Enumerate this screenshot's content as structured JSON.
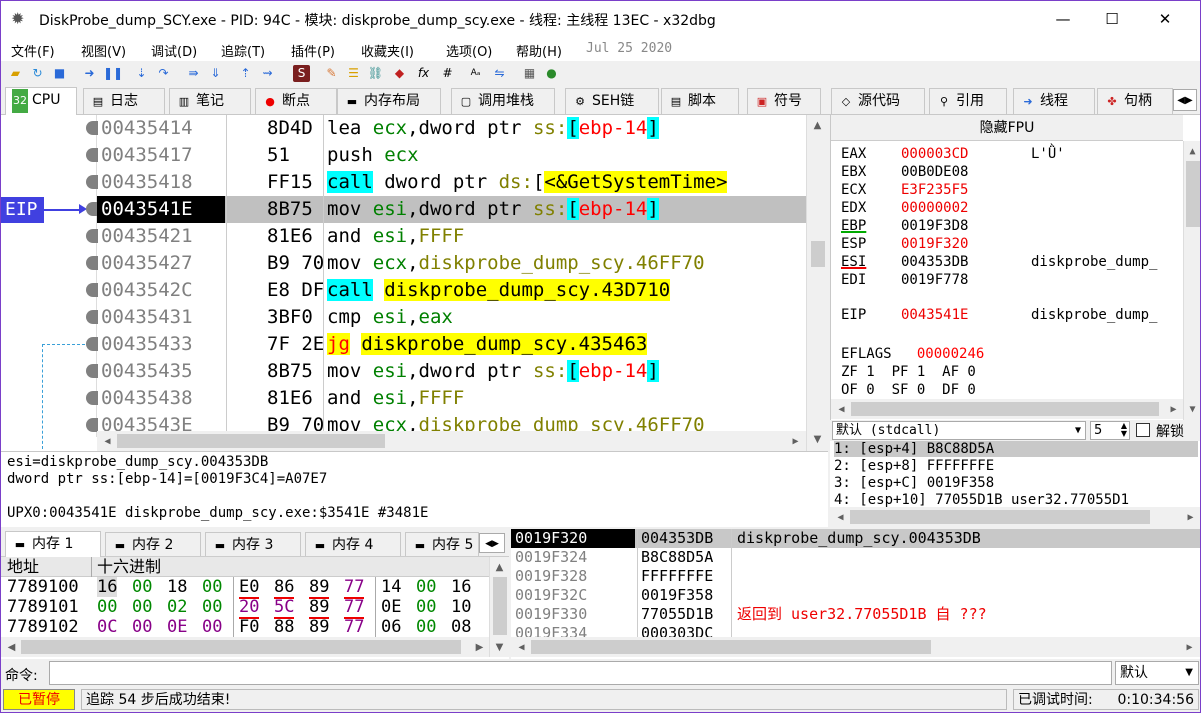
{
  "title": "DiskProbe_dump_SCY.exe - PID: 94C - 模块: diskprobe_dump_scy.exe - 线程: 主线程 13EC - x32dbg",
  "window_buttons": {
    "min": "—",
    "max": "☐",
    "close": "✕"
  },
  "menu": [
    "文件(F)",
    "视图(V)",
    "调试(D)",
    "追踪(T)",
    "插件(P)",
    "收藏夹(I)",
    "选项(O)",
    "帮助(H)",
    "Jul 25 2020"
  ],
  "tabs": [
    "CPU",
    "日志",
    "笔记",
    "断点",
    "内存布局",
    "调用堆栈",
    "SEH链",
    "脚本",
    "符号",
    "源代码",
    "引用",
    "线程",
    "句柄"
  ],
  "eip_label": "EIP",
  "disasm": [
    {
      "addr": "00435414",
      "bytes": "8D4D",
      "parts": [
        [
          "lea ",
          ""
        ],
        [
          "ecx",
          "reg"
        ],
        [
          ",",
          ""
        ],
        [
          "dword ptr ",
          "kw"
        ],
        [
          "ss:",
          "seg"
        ],
        [
          "[",
          "brk"
        ],
        [
          "ebp-14",
          "red"
        ],
        [
          "]",
          "brk"
        ]
      ]
    },
    {
      "addr": "00435417",
      "bytes": "51",
      "parts": [
        [
          "push ",
          ""
        ],
        [
          "ecx",
          "reg"
        ]
      ]
    },
    {
      "addr": "00435418",
      "bytes": "FF15",
      "parts": [
        [
          "call",
          "call"
        ],
        [
          " dword ptr ",
          ""
        ],
        [
          "ds:",
          "seg"
        ],
        [
          "[",
          ""
        ],
        [
          "<&GetSystemTime>",
          "yel"
        ]
      ]
    },
    {
      "addr": "0043541E",
      "bytes": "8B75",
      "parts": [
        [
          "mov ",
          ""
        ],
        [
          "esi",
          "reg"
        ],
        [
          ",",
          ""
        ],
        [
          "dword ptr ",
          ""
        ],
        [
          "ss:",
          "seg"
        ],
        [
          "[",
          "brk"
        ],
        [
          "ebp-14",
          "red"
        ],
        [
          "]",
          "brk"
        ]
      ],
      "eip": true
    },
    {
      "addr": "00435421",
      "bytes": "81E6",
      "parts": [
        [
          "and ",
          ""
        ],
        [
          "esi",
          "reg"
        ],
        [
          ",",
          ""
        ],
        [
          "FFFF",
          "olive"
        ]
      ]
    },
    {
      "addr": "00435427",
      "bytes": "B9 70",
      "parts": [
        [
          "mov ",
          ""
        ],
        [
          "ecx",
          "reg"
        ],
        [
          ",",
          ""
        ],
        [
          "diskprobe_dump_scy.46FF70",
          "olive"
        ]
      ]
    },
    {
      "addr": "0043542C",
      "bytes": "E8 DF",
      "parts": [
        [
          "call",
          "call"
        ],
        [
          " ",
          ""
        ],
        [
          "diskprobe_dump_scy.43D710",
          "yel"
        ]
      ]
    },
    {
      "addr": "00435431",
      "bytes": "3BF0",
      "parts": [
        [
          "cmp ",
          ""
        ],
        [
          "esi",
          "reg"
        ],
        [
          ",",
          ""
        ],
        [
          "eax",
          "reg"
        ]
      ]
    },
    {
      "addr": "00435433",
      "bytes": "7F 2E",
      "parts": [
        [
          "jg",
          "jg"
        ],
        [
          " ",
          ""
        ],
        [
          "diskprobe_dump_scy.435463",
          "yel"
        ]
      ]
    },
    {
      "addr": "00435435",
      "bytes": "8B75",
      "parts": [
        [
          "mov ",
          ""
        ],
        [
          "esi",
          "reg"
        ],
        [
          ",",
          ""
        ],
        [
          "dword ptr ",
          ""
        ],
        [
          "ss:",
          "seg"
        ],
        [
          "[",
          "brk"
        ],
        [
          "ebp-14",
          "red"
        ],
        [
          "]",
          "brk"
        ]
      ]
    },
    {
      "addr": "00435438",
      "bytes": "81E6",
      "parts": [
        [
          "and ",
          ""
        ],
        [
          "esi",
          "reg"
        ],
        [
          ",",
          ""
        ],
        [
          "FFFF",
          "olive"
        ]
      ]
    },
    {
      "addr": "0043543E",
      "bytes": "B9 70",
      "parts": [
        [
          "mov ",
          ""
        ],
        [
          "ecx",
          "reg"
        ],
        [
          ",",
          ""
        ],
        [
          "diskprobe_dump_scy.46FF70",
          "olive"
        ]
      ]
    }
  ],
  "fpu_header": "隐藏FPU",
  "registers": [
    {
      "name": "EAX",
      "value": "000003CD",
      "comment": "L'Ǜ'",
      "red": true
    },
    {
      "name": "EBX",
      "value": "00B0DE08",
      "comment": ""
    },
    {
      "name": "ECX",
      "value": "E3F235F5",
      "comment": "",
      "red": true
    },
    {
      "name": "EDX",
      "value": "00000002",
      "comment": "",
      "red": true
    },
    {
      "name": "EBP",
      "value": "0019F3D8",
      "comment": "",
      "ul": "green"
    },
    {
      "name": "ESP",
      "value": "0019F320",
      "comment": "",
      "red": true
    },
    {
      "name": "ESI",
      "value": "004353DB",
      "comment": "diskprobe_dump_",
      "ul": "red"
    },
    {
      "name": "EDI",
      "value": "0019F778",
      "comment": ""
    },
    {
      "name": "EIP",
      "value": "0043541E",
      "comment": "diskprobe_dump_",
      "red": true,
      "gap": true
    }
  ],
  "eflags": {
    "label": "EFLAGS",
    "value": "00000246",
    "line1": "ZF 1  PF 1  AF 0",
    "line2": "OF 0  SF 0  DF 0"
  },
  "callconv": {
    "label": "默认 (stdcall)",
    "count": "5",
    "unlock": "解锁"
  },
  "stack_args": [
    "1: [esp+4] B8C88D5A",
    "2: [esp+8] FFFFFFFE",
    "3: [esp+C] 0019F358",
    "4: [esp+10] 77055D1B user32.77055D1"
  ],
  "info": [
    "esi=diskprobe_dump_scy.004353DB",
    "dword ptr ss:[ebp-14]=[0019F3C4]=A07E7",
    "",
    "UPX0:0043541E diskprobe_dump_scy.exe:$3541E #3481E"
  ],
  "dump_tabs": [
    "内存 1",
    "内存 2",
    "内存 3",
    "内存 4",
    "内存 5"
  ],
  "dump_header": {
    "addr": "地址",
    "hex": "十六进制"
  },
  "dump_rows": [
    {
      "addr": "7789100",
      "b": [
        "16",
        "00",
        "18",
        "00",
        "E0",
        "86",
        "89",
        "77",
        "14",
        "00",
        "16"
      ]
    },
    {
      "addr": "7789101",
      "b": [
        "00",
        "00",
        "02",
        "00",
        "20",
        "5C",
        "89",
        "77",
        "0E",
        "00",
        "10"
      ]
    },
    {
      "addr": "7789102",
      "b": [
        "0C",
        "00",
        "0E",
        "00",
        "F0",
        "88",
        "89",
        "77",
        "06",
        "00",
        "08"
      ]
    }
  ],
  "stack_rows": [
    {
      "addr": "0019F320",
      "val": "004353DB",
      "cmt": "diskprobe_dump_scy.004353DB",
      "sel": true
    },
    {
      "addr": "0019F324",
      "val": "B8C88D5A",
      "cmt": ""
    },
    {
      "addr": "0019F328",
      "val": "FFFFFFFE",
      "cmt": ""
    },
    {
      "addr": "0019F32C",
      "val": "0019F358",
      "cmt": ""
    },
    {
      "addr": "0019F330",
      "val": "77055D1B",
      "cmt": "返回到 user32.77055D1B 自 ???",
      "red": true
    },
    {
      "addr": "0019F334",
      "val": "000303DC",
      "cmt": ""
    }
  ],
  "cmd_label": "命令:",
  "cmd_default": "默认",
  "status": {
    "paused": "已暂停",
    "msg": "追踪 54 步后成功结束!",
    "time_label": "已调试时间:",
    "time": "0:10:34:56"
  }
}
